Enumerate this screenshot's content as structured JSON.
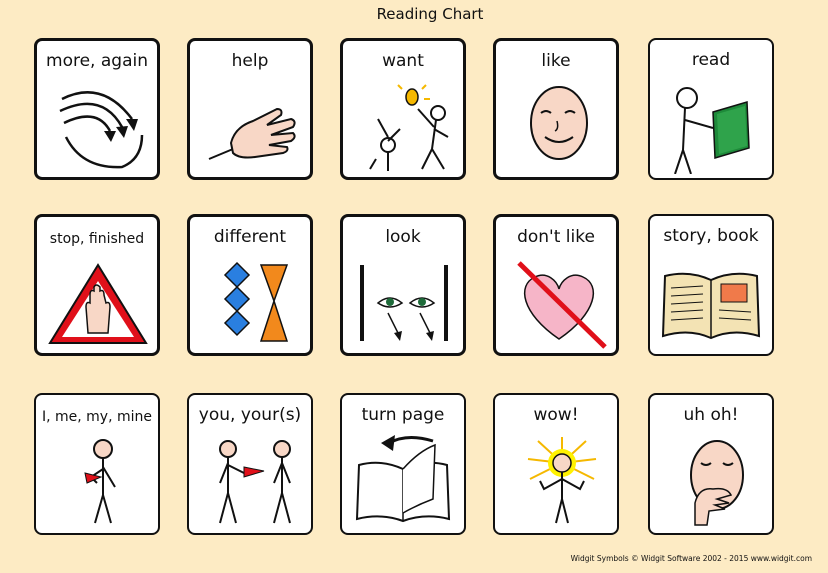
{
  "title": "Reading Chart",
  "cards": [
    {
      "label": "more, again",
      "icon": "more-again-icon"
    },
    {
      "label": "help",
      "icon": "help-hand-icon"
    },
    {
      "label": "want",
      "icon": "want-icon"
    },
    {
      "label": "like",
      "icon": "smiling-face-icon"
    },
    {
      "label": "read",
      "icon": "person-reading-icon"
    },
    {
      "label": "stop, finished",
      "icon": "stop-hand-icon"
    },
    {
      "label": "different",
      "icon": "different-shapes-icon"
    },
    {
      "label": "look",
      "icon": "eyes-look-icon"
    },
    {
      "label": "don't like",
      "icon": "crossed-heart-icon"
    },
    {
      "label": "story, book",
      "icon": "open-book-icon"
    },
    {
      "label": "I, me, my, mine",
      "icon": "self-point-icon"
    },
    {
      "label": "you, your(s)",
      "icon": "point-other-icon"
    },
    {
      "label": "turn page",
      "icon": "turn-page-icon"
    },
    {
      "label": "wow!",
      "icon": "wow-person-icon"
    },
    {
      "label": "uh oh!",
      "icon": "uh-oh-face-icon"
    }
  ],
  "footer": "Widgit Symbols © Widgit Software 2002 - 2015 www.widgit.com",
  "colors": {
    "background": "#fdebc4",
    "book_green": "#1e8a3a",
    "stop_red": "#e0101a",
    "heart_pink": "#f6b5c8",
    "blue": "#2a7fe0",
    "orange": "#f2891c",
    "glow_yellow": "#fff200"
  }
}
